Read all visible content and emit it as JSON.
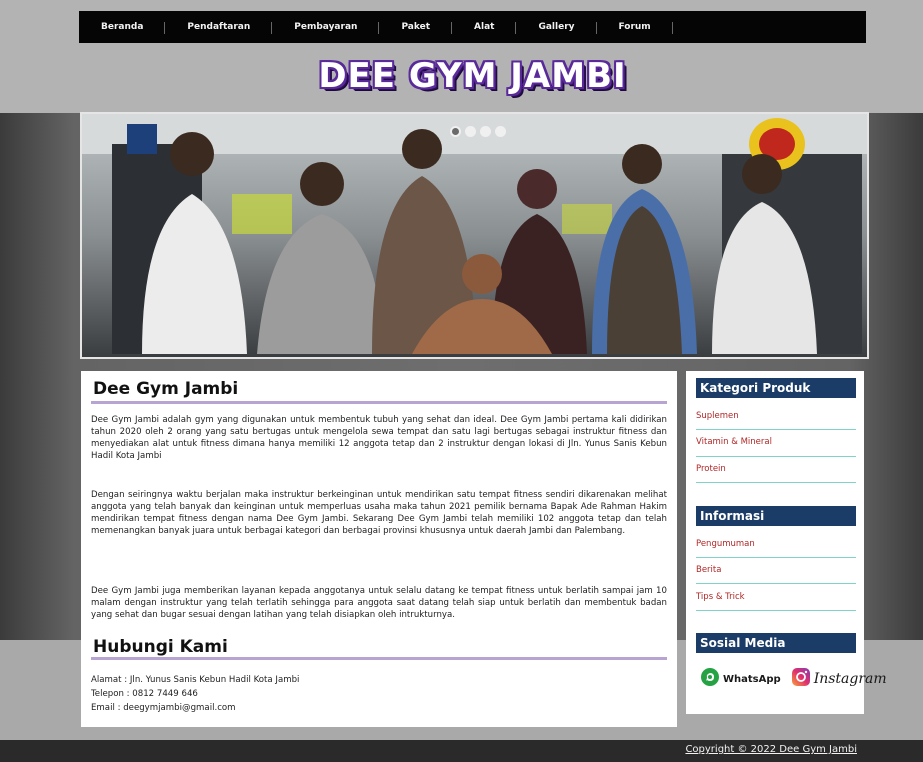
{
  "nav": {
    "items": [
      "Beranda",
      "Pendaftaran",
      "Pembayaran",
      "Paket",
      "Alat",
      "Gallery",
      "Forum"
    ]
  },
  "brand": {
    "title": "DEE GYM JAMBI"
  },
  "slider": {
    "dots": 4,
    "active": 1
  },
  "main": {
    "about_title": "Dee Gym Jambi",
    "paragraphs": [
      "Dee Gym Jambi adalah gym yang digunakan untuk membentuk tubuh yang sehat dan ideal. Dee Gym Jambi pertama kali didirikan tahun 2020 oleh 2 orang yang satu bertugas untuk mengelola sewa tempat dan satu lagi bertugas sebagai instruktur fitness dan menyediakan alat untuk fitness dimana hanya memiliki 12 anggota tetap dan 2 instruktur dengan lokasi di Jln. Yunus Sanis Kebun Hadil Kota Jambi",
      "Dengan seiringnya waktu berjalan maka instruktur berkeinginan untuk mendirikan satu tempat fitness sendiri dikarenakan melihat anggota yang telah banyak dan keinginan untuk memperluas usaha maka tahun 2021 pemilik bernama Bapak Ade Rahman Hakim mendirikan tempat fitness dengan nama Dee Gym Jambi. Sekarang Dee Gym Jambi telah memiliki 102 anggota tetap dan telah memenangkan banyak juara untuk berbagai kategori dan berbagai provinsi khususnya untuk daerah Jambi dan Palembang.",
      "Dee Gym Jambi juga memberikan layanan kepada anggotanya untuk selalu datang ke tempat fitness untuk berlatih sampai jam 10 malam dengan instruktur yang telah terlatih sehingga para anggota saat datang telah siap untuk berlatih dan membentuk badan yang sehat dan bugar sesuai dengan latihan yang telah disiapkan oleh intrukturnya."
    ],
    "contact_title": "Hubungi Kami",
    "address": "Alamat : Jln. Yunus Sanis Kebun Hadil Kota Jambi",
    "phone": "Telepon : 0812 7449 646",
    "email": "Email : deegymjambi@gmail.com"
  },
  "sidebar": {
    "kategori_title": "Kategori Produk",
    "kategori": [
      "Suplemen",
      "Vitamin & Mineral",
      "Protein"
    ],
    "info_title": "Informasi",
    "info": [
      "Pengumuman",
      "Berita",
      "Tips & Trick"
    ],
    "sosial_title": "Sosial Media",
    "whatsapp": "WhatsApp",
    "instagram": "Instagram"
  },
  "footer": {
    "copyright": "Copyright © 2022 Dee Gym Jambi"
  },
  "colors": {
    "nav_bg": "#050505",
    "sidebar_title_bg": "#1b3c66",
    "heading_underline": "#b8a4d3",
    "link_red": "#b02727",
    "brand_purple": "#5a2a9a"
  },
  "icons": [
    "whatsapp-icon",
    "instagram-icon"
  ]
}
